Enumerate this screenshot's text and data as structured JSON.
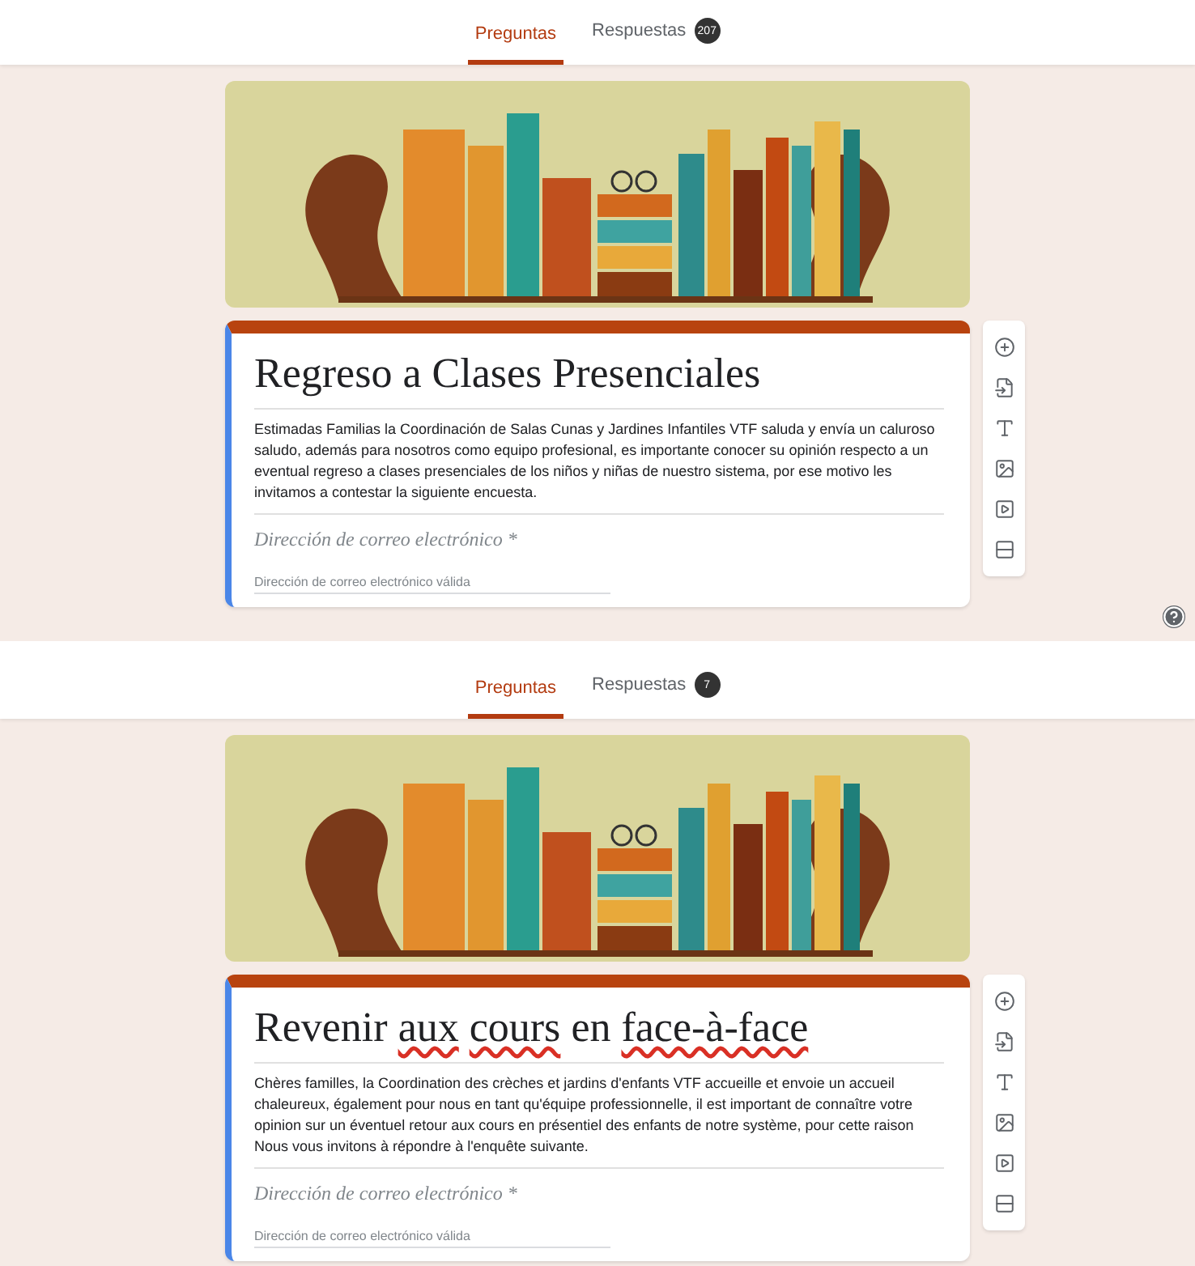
{
  "panels": [
    {
      "tabs": [
        {
          "label": "Preguntas",
          "selected": true
        },
        {
          "label": "Respuestas",
          "selected": false,
          "badge": "207"
        }
      ],
      "title_words": [
        {
          "text": "Regreso",
          "misspelled": false
        },
        {
          "text": "a",
          "misspelled": false
        },
        {
          "text": "Clases",
          "misspelled": false
        },
        {
          "text": "Presenciales",
          "misspelled": false
        }
      ],
      "description": "Estimadas Familias la Coordinación de Salas Cunas y Jardines Infantiles VTF saluda y envía un caluroso saludo, además para nosotros como equipo profesional, es importante conocer su opinión respecto a un eventual regreso a clases presenciales de los niños y niñas de nuestro sistema, por ese motivo les invitamos a contestar la siguiente encuesta.",
      "question": {
        "label": "Dirección de correo electrónico *",
        "placeholder": "Dirección de correo electrónico válida"
      },
      "help_button": true
    },
    {
      "tabs": [
        {
          "label": "Preguntas",
          "selected": true
        },
        {
          "label": "Respuestas",
          "selected": false,
          "badge": "7"
        }
      ],
      "title_words": [
        {
          "text": "Revenir",
          "misspelled": false
        },
        {
          "text": "aux",
          "misspelled": true
        },
        {
          "text": "cours",
          "misspelled": true
        },
        {
          "text": "en",
          "misspelled": false
        },
        {
          "text": "face-à-face",
          "misspelled": true
        }
      ],
      "description": "Chères familles, la Coordination des crèches et jardins d'enfants VTF accueille et envoie un accueil chaleureux, également pour nous en tant qu'équipe professionnelle, il est important de connaître votre opinion sur un éventuel retour aux cours en présentiel des enfants de notre système, pour cette raison Nous vous invitons à répondre à l'enquête suivante.",
      "question": {
        "label": "Dirección de correo electrónico *",
        "placeholder": "Dirección de correo electrónico válida"
      },
      "help_button": false
    }
  ]
}
